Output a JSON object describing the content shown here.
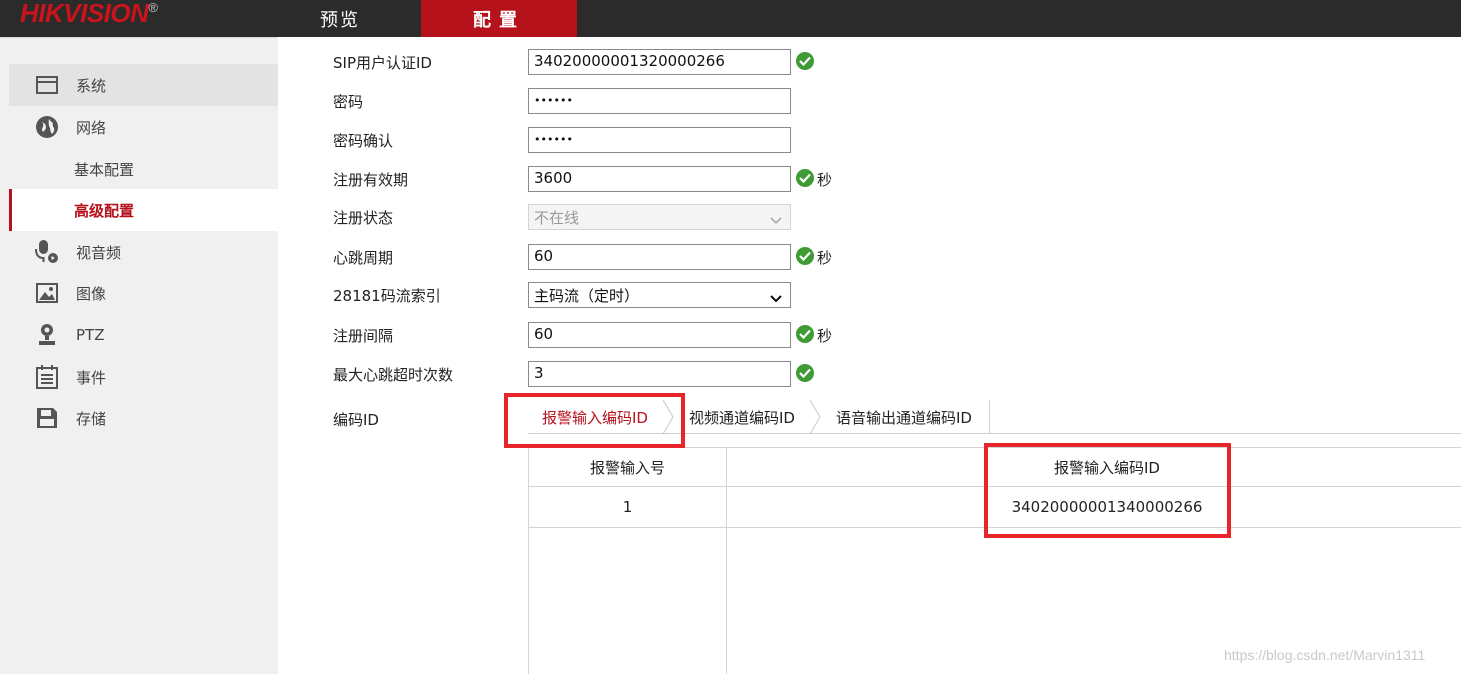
{
  "header": {
    "logo": "HIKVISION",
    "logo_mark": "®",
    "nav": [
      {
        "label": "预览",
        "active": false
      },
      {
        "label": "配置",
        "active": true
      }
    ]
  },
  "sidebar": {
    "items": [
      {
        "label": "系统",
        "icon": "monitor-window-icon"
      },
      {
        "label": "网络",
        "icon": "globe-icon"
      },
      {
        "label": "基本配置",
        "sub": true
      },
      {
        "label": "高级配置",
        "sub": true,
        "active": true
      },
      {
        "label": "视音频",
        "icon": "microphone-icon"
      },
      {
        "label": "图像",
        "icon": "image-icon"
      },
      {
        "label": "PTZ",
        "icon": "ptz-camera-icon"
      },
      {
        "label": "事件",
        "icon": "calendar-list-icon"
      },
      {
        "label": "存储",
        "icon": "floppy-disk-icon"
      }
    ]
  },
  "form": {
    "sip_id_label": "SIP用户认证ID",
    "sip_id_value": "34020000001320000266",
    "password_label": "密码",
    "password_value": "••••••",
    "password_confirm_label": "密码确认",
    "password_confirm_value": "••••••",
    "reg_validity_label": "注册有效期",
    "reg_validity_value": "3600",
    "reg_status_label": "注册状态",
    "reg_status_value": "不在线",
    "heartbeat_label": "心跳周期",
    "heartbeat_value": "60",
    "stream_index_label": "28181码流索引",
    "stream_index_value": "主码流（定时）",
    "reg_interval_label": "注册间隔",
    "reg_interval_value": "60",
    "max_timeout_label": "最大心跳超时次数",
    "max_timeout_value": "3",
    "unit_seconds": "秒"
  },
  "code_id": {
    "label": "编码ID",
    "tabs": [
      {
        "label": "报警输入编码ID",
        "active": true
      },
      {
        "label": "视频通道编码ID",
        "active": false
      },
      {
        "label": "语音输出通道编码ID",
        "active": false
      }
    ],
    "table": {
      "headers": [
        "报警输入号",
        "报警输入编码ID"
      ],
      "rows": [
        [
          "1",
          "34020000001340000266"
        ]
      ]
    }
  },
  "watermark": "https://blog.csdn.net/Marvin1311",
  "colors": {
    "brand_red": "#b5121b",
    "ok_green": "#3f9c35",
    "highlight_box": "#e8252b"
  }
}
